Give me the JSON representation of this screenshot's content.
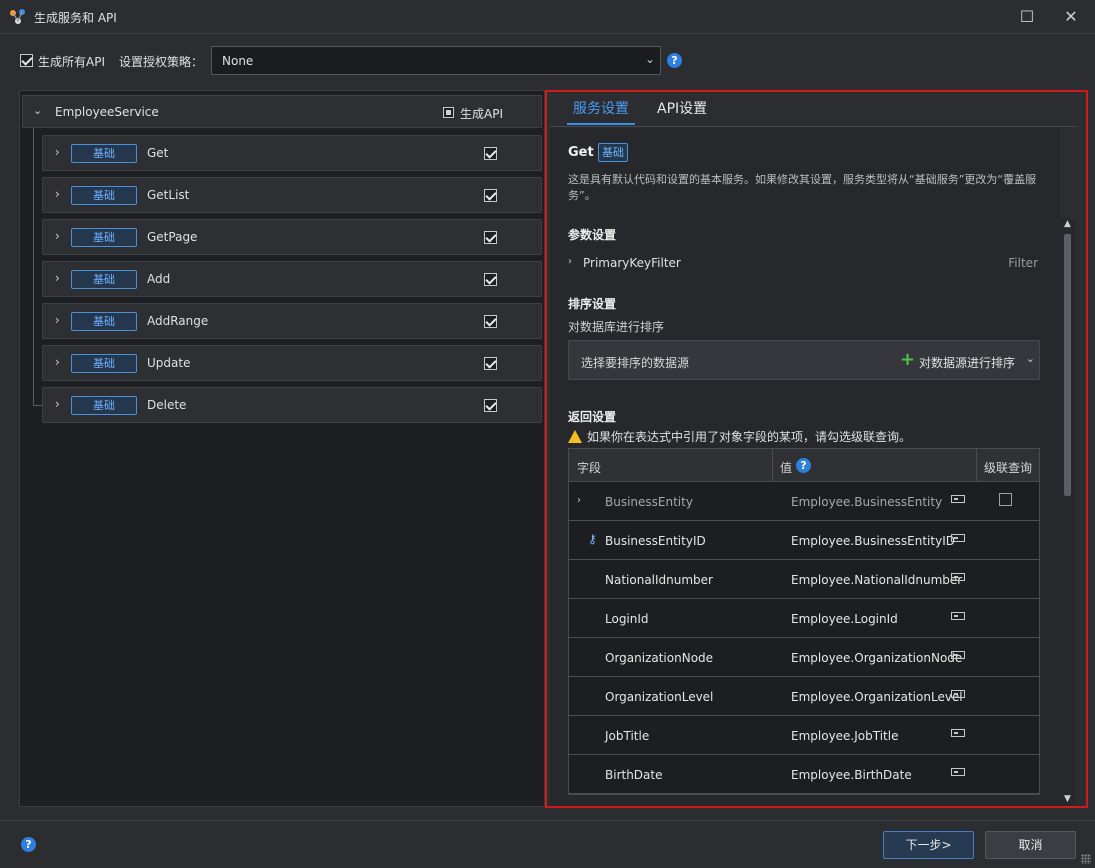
{
  "window": {
    "title": "生成服务和 API",
    "maximize_glyph": "☐",
    "close_glyph": "✕"
  },
  "toolbar": {
    "generate_all_label": "生成所有API",
    "generate_all_checked": true,
    "policy_label": "设置授权策略：",
    "policy_value": "None"
  },
  "service": {
    "name": "EmployeeService",
    "generate_api_label": "生成API",
    "apis": [
      {
        "badge": "基础",
        "name": "Get",
        "checked": true
      },
      {
        "badge": "基础",
        "name": "GetList",
        "checked": true
      },
      {
        "badge": "基础",
        "name": "GetPage",
        "checked": true
      },
      {
        "badge": "基础",
        "name": "Add",
        "checked": true
      },
      {
        "badge": "基础",
        "name": "AddRange",
        "checked": true
      },
      {
        "badge": "基础",
        "name": "Update",
        "checked": true
      },
      {
        "badge": "基础",
        "name": "Delete",
        "checked": true
      }
    ]
  },
  "detail": {
    "tabs": [
      {
        "label": "服务设置",
        "active": true
      },
      {
        "label": "API设置",
        "active": false
      }
    ],
    "service_name": "Get",
    "service_badge": "基础",
    "description": "这是具有默认代码和设置的基本服务。如果修改其设置，服务类型将从“基础服务”更改为“覆盖服务”。",
    "params": {
      "title": "参数设置",
      "items": [
        {
          "name": "PrimaryKeyFilter",
          "type": "Filter"
        }
      ]
    },
    "sort": {
      "title": "排序设置",
      "subtitle": "对数据库进行排序",
      "placeholder": "选择要排序的数据源",
      "action": "对数据源进行排序"
    },
    "return": {
      "title": "返回设置",
      "warning": "如果你在表达式中引用了对象字段的某项，请勾选级联查询。",
      "columns": [
        "字段",
        "值",
        "级联查询"
      ],
      "rows": [
        {
          "field": "BusinessEntity",
          "value": "Employee.BusinessEntity",
          "expandable": true,
          "key": false,
          "cascade": false,
          "dim": true
        },
        {
          "field": "BusinessEntityID",
          "value": "Employee.BusinessEntityID",
          "expandable": false,
          "key": true,
          "dim": false
        },
        {
          "field": "NationalIdnumber",
          "value": "Employee.NationalIdnumber",
          "expandable": false,
          "key": false,
          "dim": false
        },
        {
          "field": "LoginId",
          "value": "Employee.LoginId",
          "expandable": false,
          "key": false,
          "dim": false
        },
        {
          "field": "OrganizationNode",
          "value": "Employee.OrganizationNode",
          "expandable": false,
          "key": false,
          "dim": false
        },
        {
          "field": "OrganizationLevel",
          "value": "Employee.OrganizationLevel",
          "expandable": false,
          "key": false,
          "dim": false
        },
        {
          "field": "JobTitle",
          "value": "Employee.JobTitle",
          "expandable": false,
          "key": false,
          "dim": false
        },
        {
          "field": "BirthDate",
          "value": "Employee.BirthDate",
          "expandable": false,
          "key": false,
          "dim": false
        }
      ]
    }
  },
  "footer": {
    "next_label": "下一步>",
    "cancel_label": "取消"
  },
  "colors": {
    "accent": "#3a8ee6",
    "highlight_border": "#d21a1a",
    "badge_text": "#6fb0ff"
  }
}
